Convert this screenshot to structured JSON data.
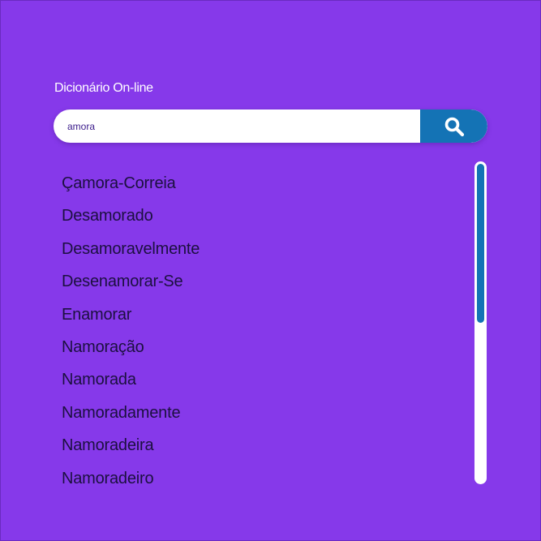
{
  "app": {
    "title": "Dicionário On-line"
  },
  "search": {
    "value": "amora",
    "button_icon": "search-icon"
  },
  "results": {
    "items": [
      "Çamora-Correia",
      "Desamorado",
      "Desamoravelmente",
      "Desenamorar-Se",
      "Enamorar",
      "Namoração",
      "Namorada",
      "Namoradamente",
      "Namoradeira",
      "Namoradeiro"
    ]
  },
  "scrollbar": {
    "position": 0,
    "visible_fraction": 0.5
  },
  "colors": {
    "background": "#8639ea",
    "accent": "#1473b5",
    "text": "#1c1040",
    "surface": "#ffffff"
  }
}
